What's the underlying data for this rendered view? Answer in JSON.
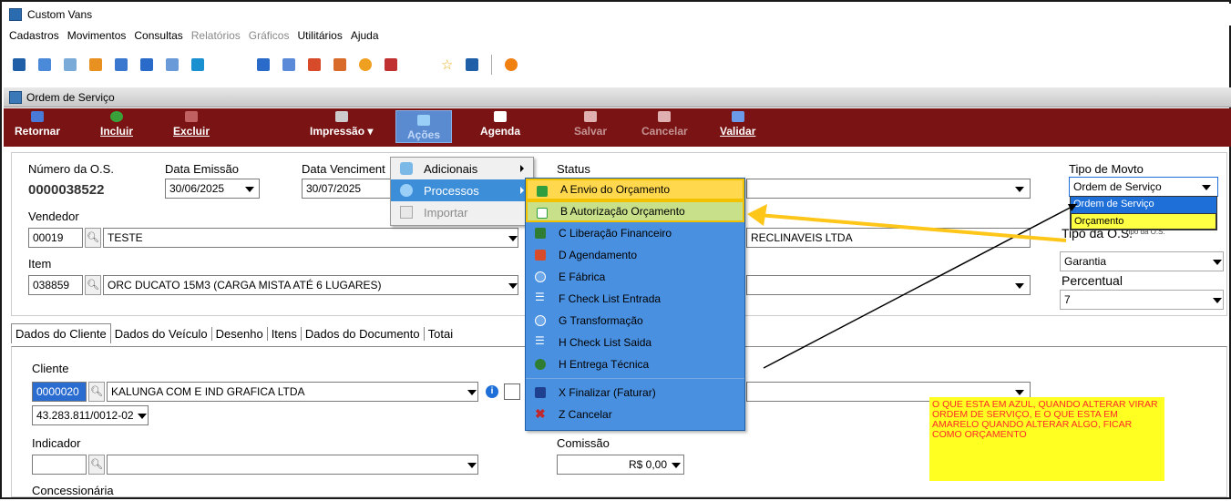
{
  "window": {
    "title": "Custom Vans"
  },
  "menu": [
    "Cadastros",
    "Movimentos",
    "Consultas",
    "Relatórios",
    "Gráficos",
    "Utilitários",
    "Ajuda"
  ],
  "menu_disabled": [
    false,
    false,
    false,
    true,
    true,
    false,
    false
  ],
  "child_window": {
    "title": "Ordem de Serviço"
  },
  "actions": {
    "retornar": "Retornar",
    "incluir": "Incluir",
    "excluir": "Excluir",
    "impressao": "Impressão",
    "acoes": "Ações",
    "agenda": "Agenda",
    "salvar": "Salvar",
    "cancelar": "Cancelar",
    "validar": "Validar"
  },
  "form": {
    "numero_label": "Número da O.S.",
    "numero_value": "0000038522",
    "data_emissao_label": "Data Emissão",
    "data_emissao_value": "30/06/2025",
    "data_venc_label": "Data Venciment",
    "data_venc_value": "30/07/2025",
    "status_label": "Status",
    "tipo_movto_label": "Tipo de Movto",
    "tipo_movto_value": "Ordem de Serviço",
    "vendedor_label": "Vendedor",
    "vendedor_code": "00019",
    "vendedor_name": "TESTE",
    "cliente_trunc": "RECLINAVEIS LTDA",
    "tipo_os_label": "Tipo da O.S.",
    "tipo_os_value": "Garantia",
    "item_label": "Item",
    "item_code": "038859",
    "item_name": "ORC DUCATO 15M3 (CARGA MISTA ATÉ 6 LUGARES)",
    "percentual_label": "Percentual",
    "percentual_value": "7"
  },
  "tipo_movto_options": [
    "Ordem de Serviço",
    "Orçamento"
  ],
  "tipo_os_hidden_label": "Tipo da O.S.",
  "tabs": [
    "Dados do Cliente",
    "Dados do Veículo",
    "Desenho",
    "Itens",
    "Dados do Documento",
    "Totai"
  ],
  "cliente": {
    "label": "Cliente",
    "code": "0000020",
    "name": "KALUNGA COM E IND GRAFICA LTDA",
    "doc": "43.283.811/0012-02",
    "indicador_label": "Indicador",
    "comissao_label": "Comissão",
    "comissao_value": "R$ 0,00",
    "concessionaria_label": "Concessionária"
  },
  "context_menu": {
    "items": [
      {
        "label": "Adicionais",
        "submenu": true,
        "selected": false,
        "disabled": false
      },
      {
        "label": "Processos",
        "submenu": true,
        "selected": true,
        "disabled": false
      },
      {
        "label": "Importar",
        "submenu": false,
        "selected": false,
        "disabled": true
      }
    ]
  },
  "sub_menu": {
    "items": [
      {
        "label": "A Envio do Orçamento",
        "icon": "envelope-icon",
        "color": "#2e9e3e"
      },
      {
        "label": "B Autorização Orçamento",
        "icon": "checkbox-icon",
        "color": "#2e9e3e"
      },
      {
        "label": "C Liberação Financeiro",
        "icon": "money-bag-icon",
        "color": "#2e7d32"
      },
      {
        "label": "D Agendamento",
        "icon": "calendar-icon",
        "color": "#d84b2a"
      },
      {
        "label": "E Fábrica",
        "icon": "gear-icon",
        "color": "#6fa8e8"
      },
      {
        "label": "F Check List Entrada",
        "icon": "checklist-icon",
        "color": "#ffffff"
      },
      {
        "label": "G Transformação",
        "icon": "gear-icon",
        "color": "#6fa8e8"
      },
      {
        "label": "H Check List Saida",
        "icon": "checklist-icon",
        "color": "#ffffff"
      },
      {
        "label": "H Entrega Técnica",
        "icon": "entrega-icon",
        "color": "#2e7d32"
      },
      {
        "label": "X Finalizar (Faturar)",
        "icon": "printer-icon",
        "color": "#1f3f8f"
      },
      {
        "label": "Z Cancelar",
        "icon": "x-icon",
        "color": "#c0282d"
      }
    ]
  },
  "note": {
    "text": "O QUE ESTA EM AZUL, QUANDO ALTERAR VIRAR ORDEM DE SERVIÇO, E O QUE ESTA EM AMARELO QUANDO ALTERAR ALGO, FICAR COMO ORÇAMENTO"
  }
}
